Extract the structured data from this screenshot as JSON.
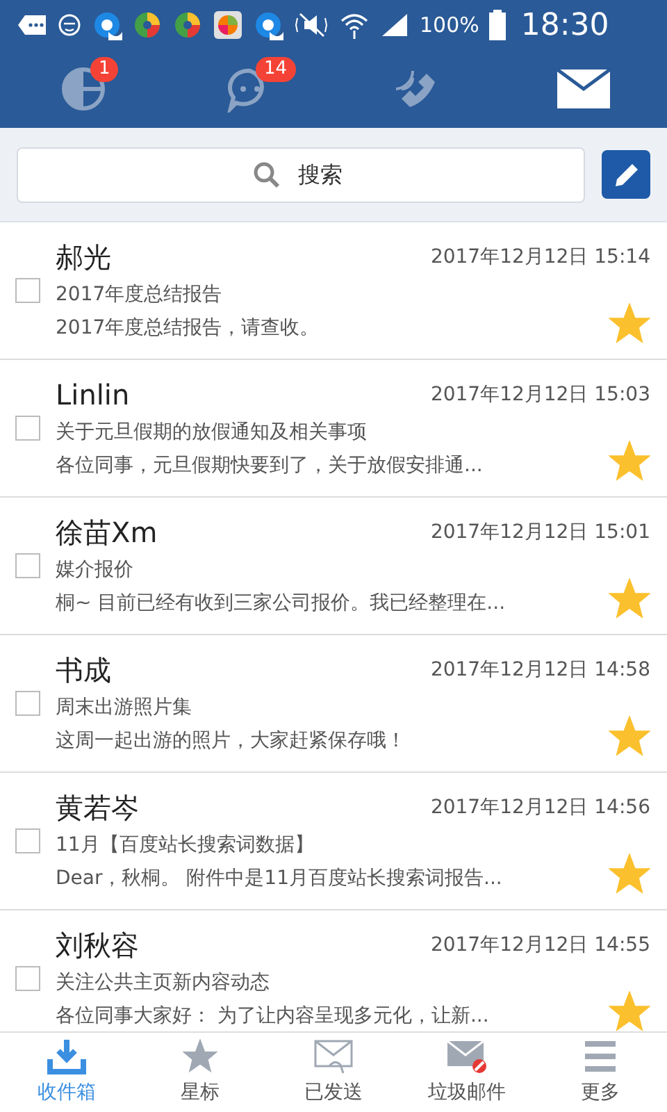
{
  "status_bar": {
    "battery": "100%",
    "time": "18:30"
  },
  "top_tabs": [
    {
      "kind": "chart",
      "badge": "1",
      "selected": false
    },
    {
      "kind": "chat",
      "badge": "14",
      "selected": false
    },
    {
      "kind": "phone",
      "selected": false
    },
    {
      "kind": "mail",
      "selected": true
    }
  ],
  "search": {
    "placeholder": "搜索"
  },
  "emails": [
    {
      "sender": "郝光",
      "date": "2017年12月12日 15:14",
      "subject": "2017年度总结报告",
      "preview": "2017年度总结报告，请查收。",
      "checked": false,
      "starred": true
    },
    {
      "sender": "Linlin",
      "date": "2017年12月12日 15:03",
      "subject": "关于元旦假期的放假通知及相关事项",
      "preview": "各位同事，元旦假期快要到了，关于放假安排通...",
      "checked": false,
      "starred": true
    },
    {
      "sender": "徐苗Xm",
      "date": "2017年12月12日 15:01",
      "subject": "媒介报价",
      "preview": "桐~ 目前已经有收到三家公司报价。我已经整理在...",
      "checked": false,
      "starred": true
    },
    {
      "sender": "书成",
      "date": "2017年12月12日 14:58",
      "subject": "周末出游照片集",
      "preview": "这周一起出游的照片，大家赶紧保存哦！",
      "checked": false,
      "starred": true
    },
    {
      "sender": "黄若岑",
      "date": "2017年12月12日 14:56",
      "subject": "11月【百度站长搜索词数据】",
      "preview": "Dear，秋桐。 附件中是11月百度站长搜索词报告...",
      "checked": false,
      "starred": true
    },
    {
      "sender": "刘秋容",
      "date": "2017年12月12日 14:55",
      "subject": "关注公共主页新内容动态",
      "preview": "各位同事大家好： 为了让内容呈现多元化，让新...",
      "checked": false,
      "starred": true
    }
  ],
  "bottom_nav": [
    {
      "kind": "inbox",
      "label": "收件箱",
      "selected": true
    },
    {
      "kind": "star",
      "label": "星标",
      "selected": false
    },
    {
      "kind": "sent",
      "label": "已发送",
      "selected": false
    },
    {
      "kind": "spam",
      "label": "垃圾邮件",
      "selected": false
    },
    {
      "kind": "more",
      "label": "更多",
      "selected": false
    }
  ]
}
